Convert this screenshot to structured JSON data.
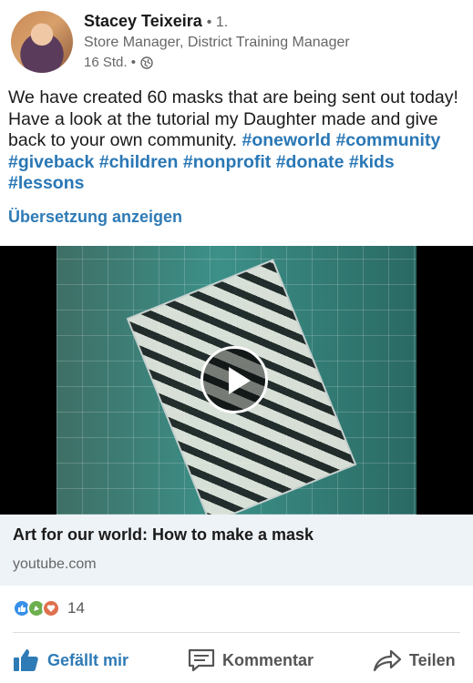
{
  "author": {
    "name": "Stacey Teixeira",
    "degree": "• 1.",
    "headline": "Store Manager, District Training Manager",
    "time": "16 Std. •"
  },
  "post": {
    "text": "We have created 60 masks that are being sent out today! Have a look at the tutorial my Daughter made and give back to your own community.",
    "hashtags": [
      "#oneworld",
      "#community",
      "#giveback",
      "#children",
      "#nonprofit",
      "#donate",
      "#kids",
      "#lessons"
    ],
    "translate_label": "Übersetzung anzeigen"
  },
  "link_card": {
    "title": "Art for our world: How to make a mask",
    "domain": "youtube.com"
  },
  "reactions": {
    "count": "14",
    "icons": [
      "like-icon",
      "celebrate-icon",
      "love-icon"
    ]
  },
  "actions": {
    "like_label": "Gefällt mir",
    "comment_label": "Kommentar",
    "share_label": "Teilen"
  },
  "colors": {
    "accent": "#2f7bb6",
    "link_card_bg": "#eef3f7"
  }
}
